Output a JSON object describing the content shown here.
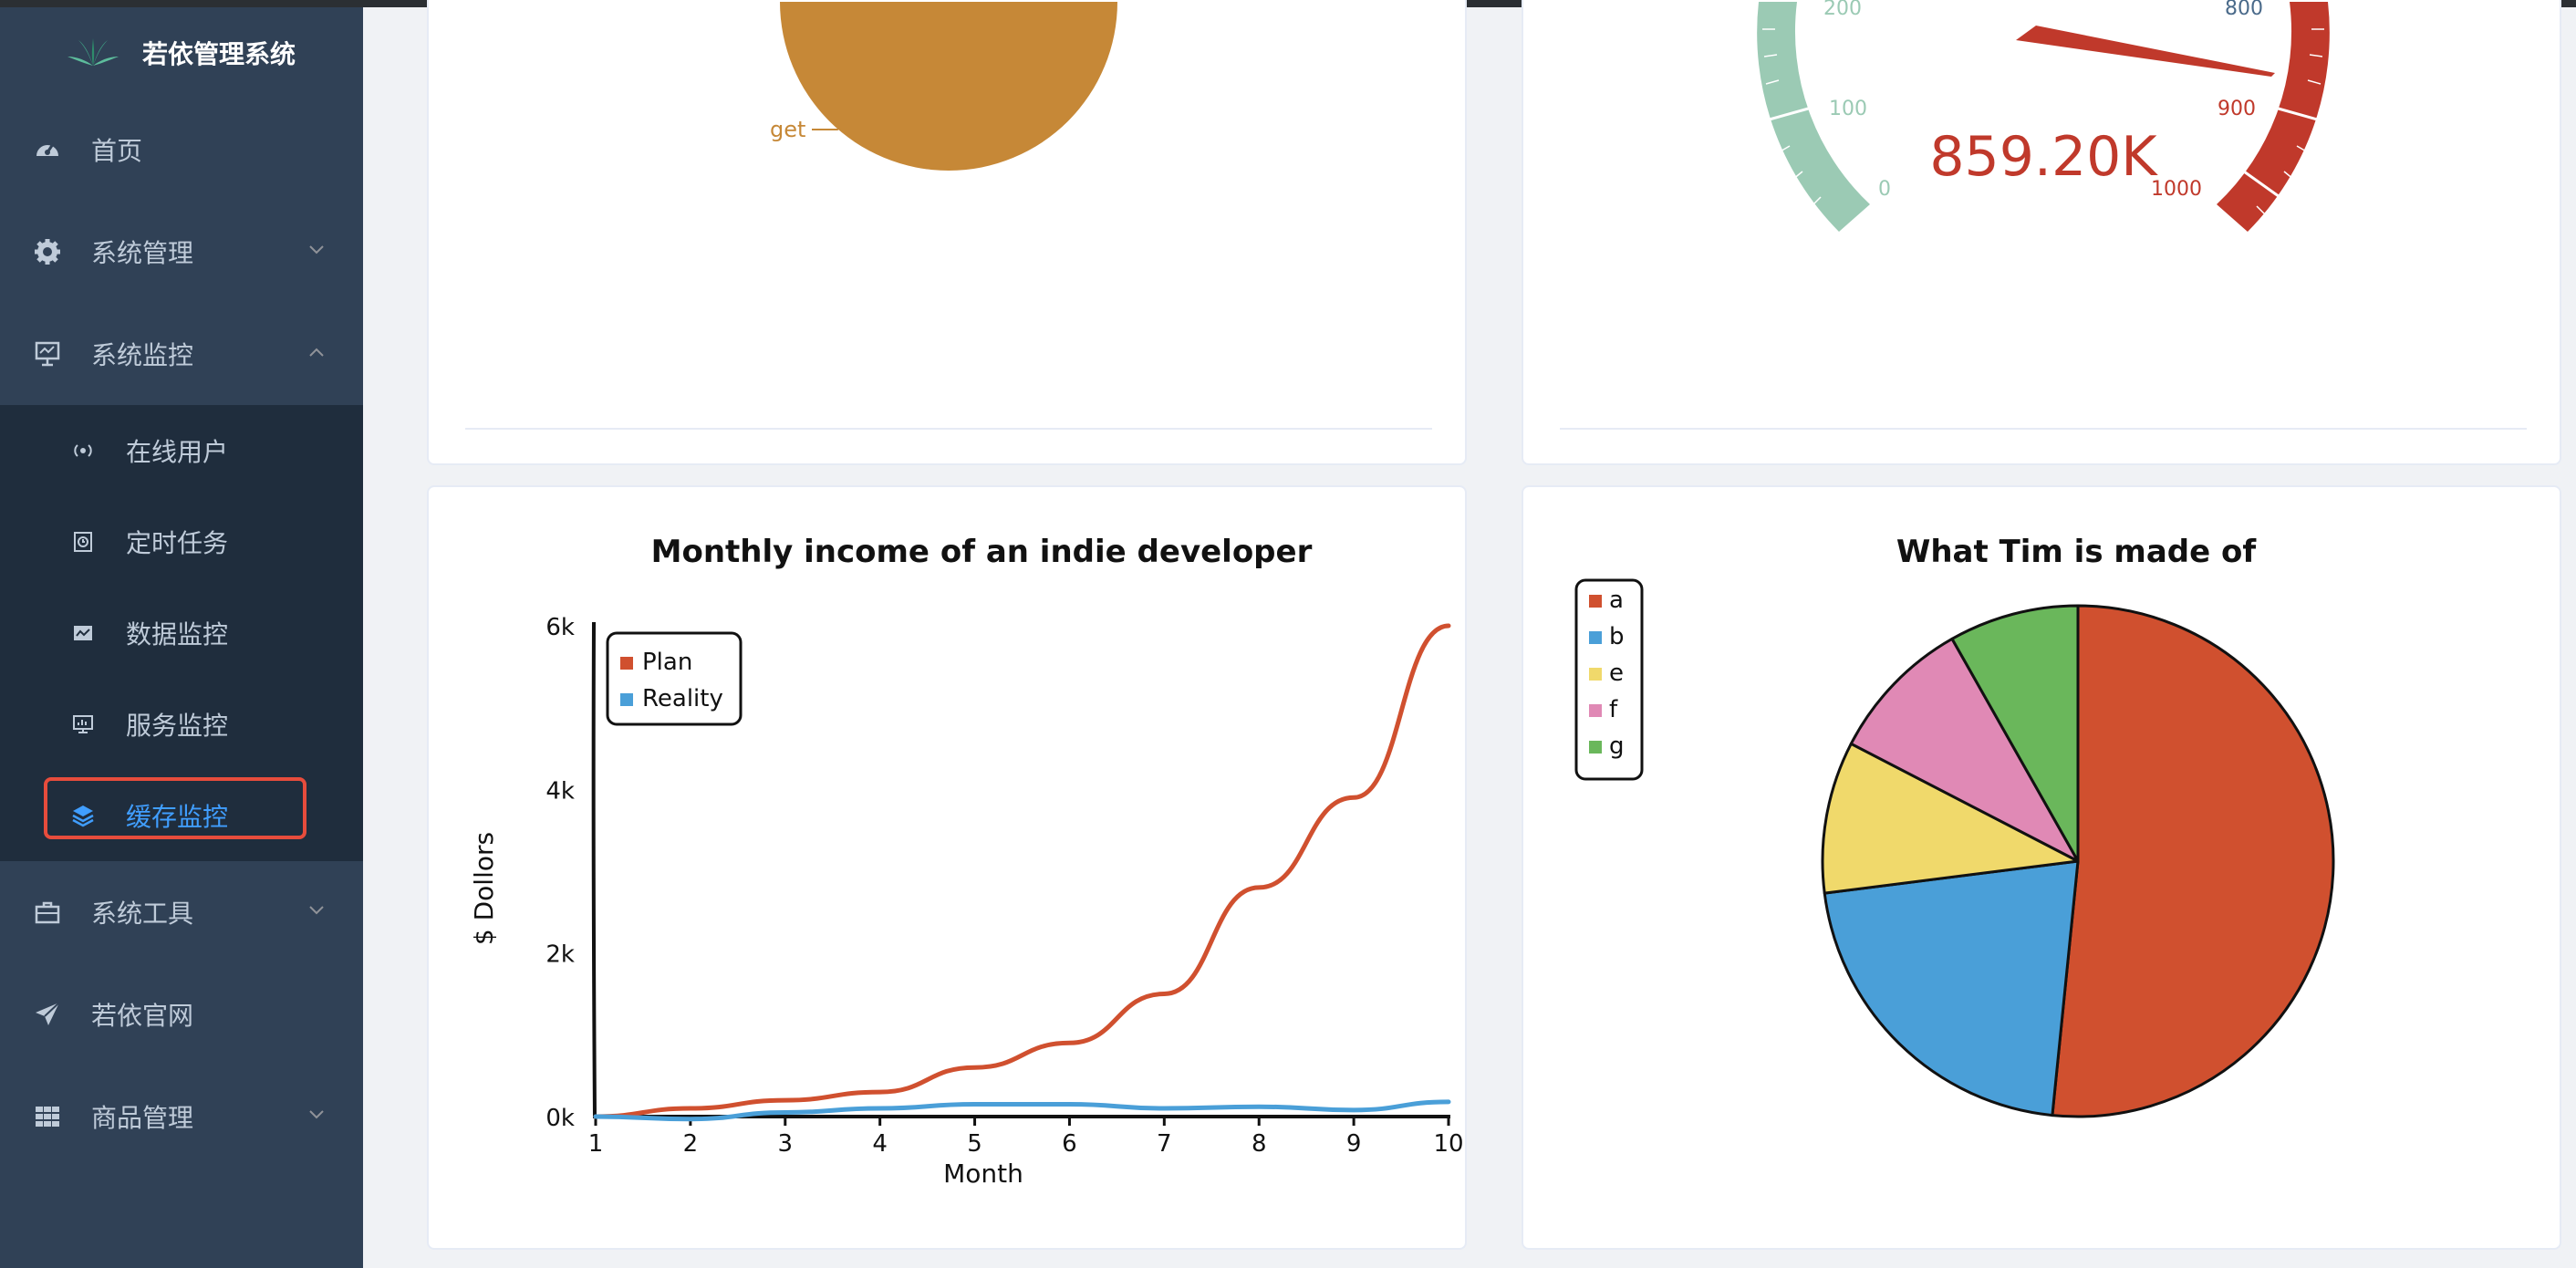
{
  "app": {
    "title": "若依管理系统"
  },
  "sidebar": {
    "items": [
      {
        "label": "首页",
        "icon": "dashboard-icon"
      },
      {
        "label": "系统管理",
        "icon": "gear-icon"
      },
      {
        "label": "系统监控",
        "icon": "monitor-icon"
      }
    ],
    "sub_items": [
      {
        "label": "在线用户",
        "icon": "online-icon"
      },
      {
        "label": "定时任务",
        "icon": "clock-icon"
      },
      {
        "label": "数据监控",
        "icon": "data-icon"
      },
      {
        "label": "服务监控",
        "icon": "server-icon"
      },
      {
        "label": "缓存监控",
        "icon": "layers-icon"
      }
    ],
    "items_after": [
      {
        "label": "系统工具",
        "icon": "toolbox-icon"
      },
      {
        "label": "若依官网",
        "icon": "send-icon"
      },
      {
        "label": "商品管理",
        "icon": "grid-icon"
      }
    ]
  },
  "top_left": {
    "pie_label": "get"
  },
  "gauge": {
    "value_text": "859.20K",
    "ticks": [
      "0",
      "100",
      "200",
      "800",
      "900",
      "1000"
    ],
    "value": 859.2,
    "max": 1000,
    "colors": {
      "low": "#9bcab4",
      "high": "#c0392b"
    }
  },
  "chart_data": [
    {
      "type": "line",
      "title": "Monthly income of an indie developer",
      "xlabel": "Month",
      "ylabel": "$ Dollors",
      "x": [
        1,
        2,
        3,
        4,
        5,
        6,
        7,
        8,
        9,
        10
      ],
      "y_ticks": [
        "0k",
        "2k",
        "4k",
        "6k"
      ],
      "ylim": [
        0,
        6000
      ],
      "legend_position": "top-left",
      "series": [
        {
          "name": "Plan",
          "color": "#d0502f",
          "values": [
            0,
            100,
            200,
            300,
            600,
            900,
            1500,
            2800,
            3900,
            6000
          ]
        },
        {
          "name": "Reality",
          "color": "#4a9fd8",
          "values": [
            0,
            -30,
            50,
            100,
            150,
            150,
            100,
            120,
            80,
            180
          ]
        }
      ]
    },
    {
      "type": "pie",
      "title": "What Tim is made of",
      "legend_position": "top-left",
      "labels": [
        "a",
        "b",
        "e",
        "f",
        "g"
      ],
      "values": [
        51.6,
        21.4,
        9.6,
        9.2,
        8.2
      ],
      "colors": [
        "#d0502f",
        "#4a9fd8",
        "#f0d96b",
        "#e089b5",
        "#6ab75b"
      ]
    }
  ]
}
